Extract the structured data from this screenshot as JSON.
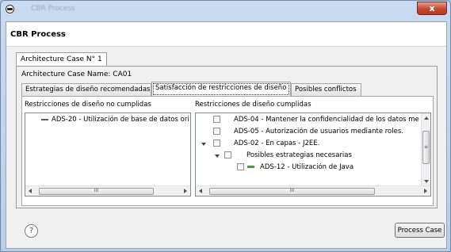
{
  "window": {
    "title": "CBR Process",
    "close_glyph": "x"
  },
  "header": {
    "title": "CBR Process"
  },
  "outer_tab": {
    "label": "Architecture Case N° 1"
  },
  "case": {
    "name_label": "Architecture Case Name: CA01"
  },
  "inner_tabs": [
    {
      "label": "Estrategias de diseño recomendadas",
      "active": false
    },
    {
      "label": "Satisfacción de restricciones de diseño",
      "active": true
    },
    {
      "label": "Posibles conflictos",
      "active": false
    }
  ],
  "left_list": {
    "label": "Restricciones de diseño no cumplidas",
    "items": [
      "ADS-20 - Utilización de base de datos ori"
    ]
  },
  "right_list": {
    "label": "Restricciones de diseño cumplidas",
    "items": [
      "ADS-04 - Mantener la confidencialidad de los datos me",
      "ADS-05 - Autorización de usuarios mediante roles.",
      "ADS-02 - En capas - J2EE.",
      "Posibles estrategias necesarias",
      "ADS-12 - Utilización de Java"
    ]
  },
  "scroll_glyph": "III",
  "footer": {
    "help_label": "?",
    "process_button": "Process Case"
  },
  "colors": {
    "close_button": "#c8472f",
    "strategy_marker": "#3aa63a",
    "window_frame": "#b9cfe8"
  }
}
